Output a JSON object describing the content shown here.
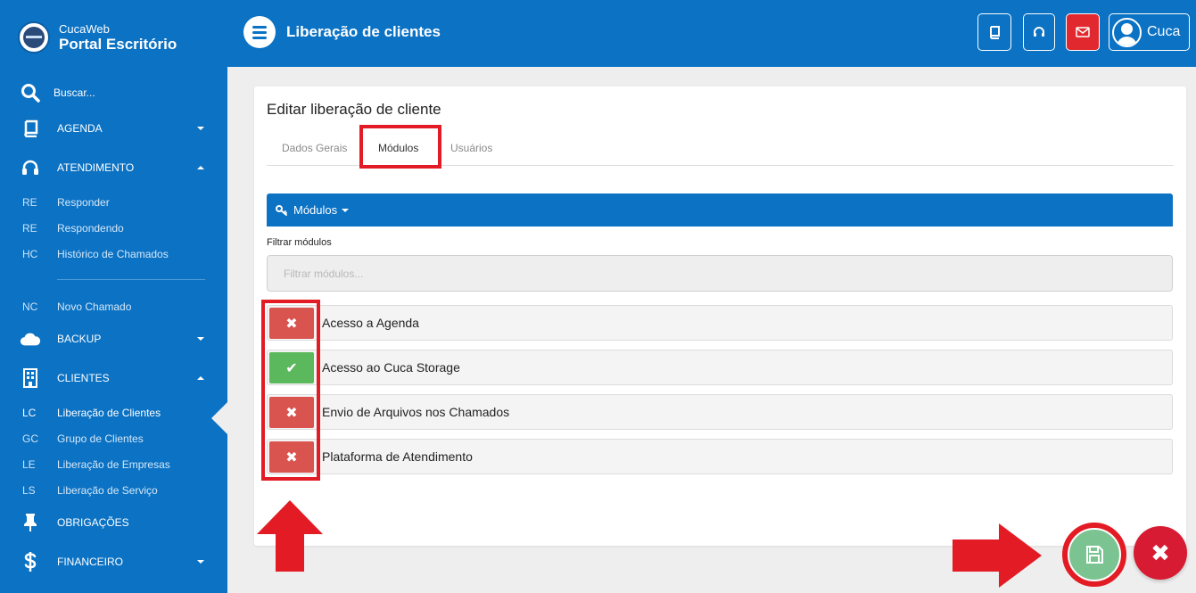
{
  "brand": {
    "small": "CucaWeb",
    "big": "Portal Escritório"
  },
  "header": {
    "title": "Liberação de clientes",
    "user": "Cuca"
  },
  "sidebar": {
    "search": "Buscar...",
    "agenda": "AGENDA",
    "atendimento": "ATENDIMENTO",
    "atendimento_items": [
      {
        "abbr": "RE",
        "label": "Responder"
      },
      {
        "abbr": "RE",
        "label": "Respondendo"
      },
      {
        "abbr": "HC",
        "label": "Histórico de Chamados"
      }
    ],
    "novo": {
      "abbr": "NC",
      "label": "Novo Chamado"
    },
    "backup": "BACKUP",
    "clientes": "CLIENTES",
    "clientes_items": [
      {
        "abbr": "LC",
        "label": "Liberação de Clientes"
      },
      {
        "abbr": "GC",
        "label": "Grupo de Clientes"
      },
      {
        "abbr": "LE",
        "label": "Liberação de Empresas"
      },
      {
        "abbr": "LS",
        "label": "Liberação de Serviço"
      }
    ],
    "obrigacoes": "OBRIGAÇÕES",
    "financeiro": "FINANCEIRO"
  },
  "card": {
    "title": "Editar liberação de cliente",
    "tabs": [
      "Dados Gerais",
      "Módulos",
      "Usuários"
    ],
    "active_tab": "Módulos",
    "section": "Módulos",
    "filter_label": "Filtrar módulos",
    "filter_placeholder": "Filtrar módulos..."
  },
  "modules": [
    {
      "label": "Acesso a Agenda",
      "enabled": false,
      "glyph": "✖"
    },
    {
      "label": "Acesso ao Cuca Storage",
      "enabled": true,
      "glyph": "✔"
    },
    {
      "label": "Envio de Arquivos nos Chamados",
      "enabled": false,
      "glyph": "✖"
    },
    {
      "label": "Plataforma de Atendimento",
      "enabled": false,
      "glyph": "✖"
    }
  ],
  "fab": {
    "close_glyph": "✖"
  },
  "colors": {
    "primary": "#0b72c4",
    "danger": "#d9534f",
    "success": "#5cb85c",
    "highlight": "#e21b24",
    "save": "#7bc492"
  }
}
